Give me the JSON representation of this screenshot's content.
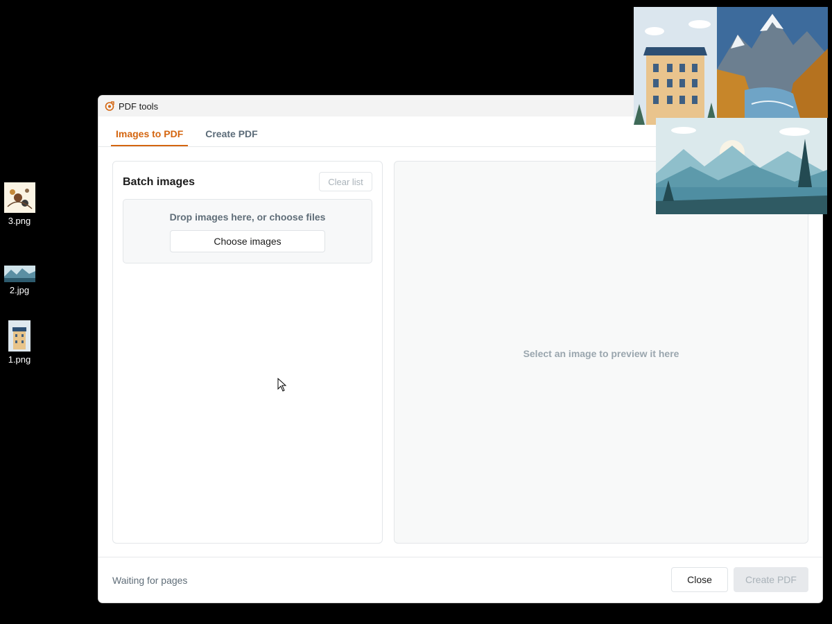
{
  "desktop": {
    "icons": [
      {
        "label": "3.png"
      },
      {
        "label": "2.jpg"
      },
      {
        "label": "1.png"
      }
    ]
  },
  "window": {
    "title": "PDF tools",
    "app_icon": "pdf-tools-icon"
  },
  "tabs": [
    {
      "label": "Images to PDF",
      "active": true
    },
    {
      "label": "Create PDF",
      "active": false
    }
  ],
  "batch": {
    "title": "Batch images",
    "clear_label": "Clear list",
    "drop_text": "Drop images here, or choose files",
    "choose_label": "Choose images"
  },
  "preview": {
    "placeholder": "Select an image to preview it here"
  },
  "footer": {
    "status": "Waiting for pages",
    "close_label": "Close",
    "create_label": "Create PDF"
  },
  "colors": {
    "accent": "#d4650f",
    "muted_text": "#5f6d78",
    "disabled_text": "#a9b2b9"
  }
}
